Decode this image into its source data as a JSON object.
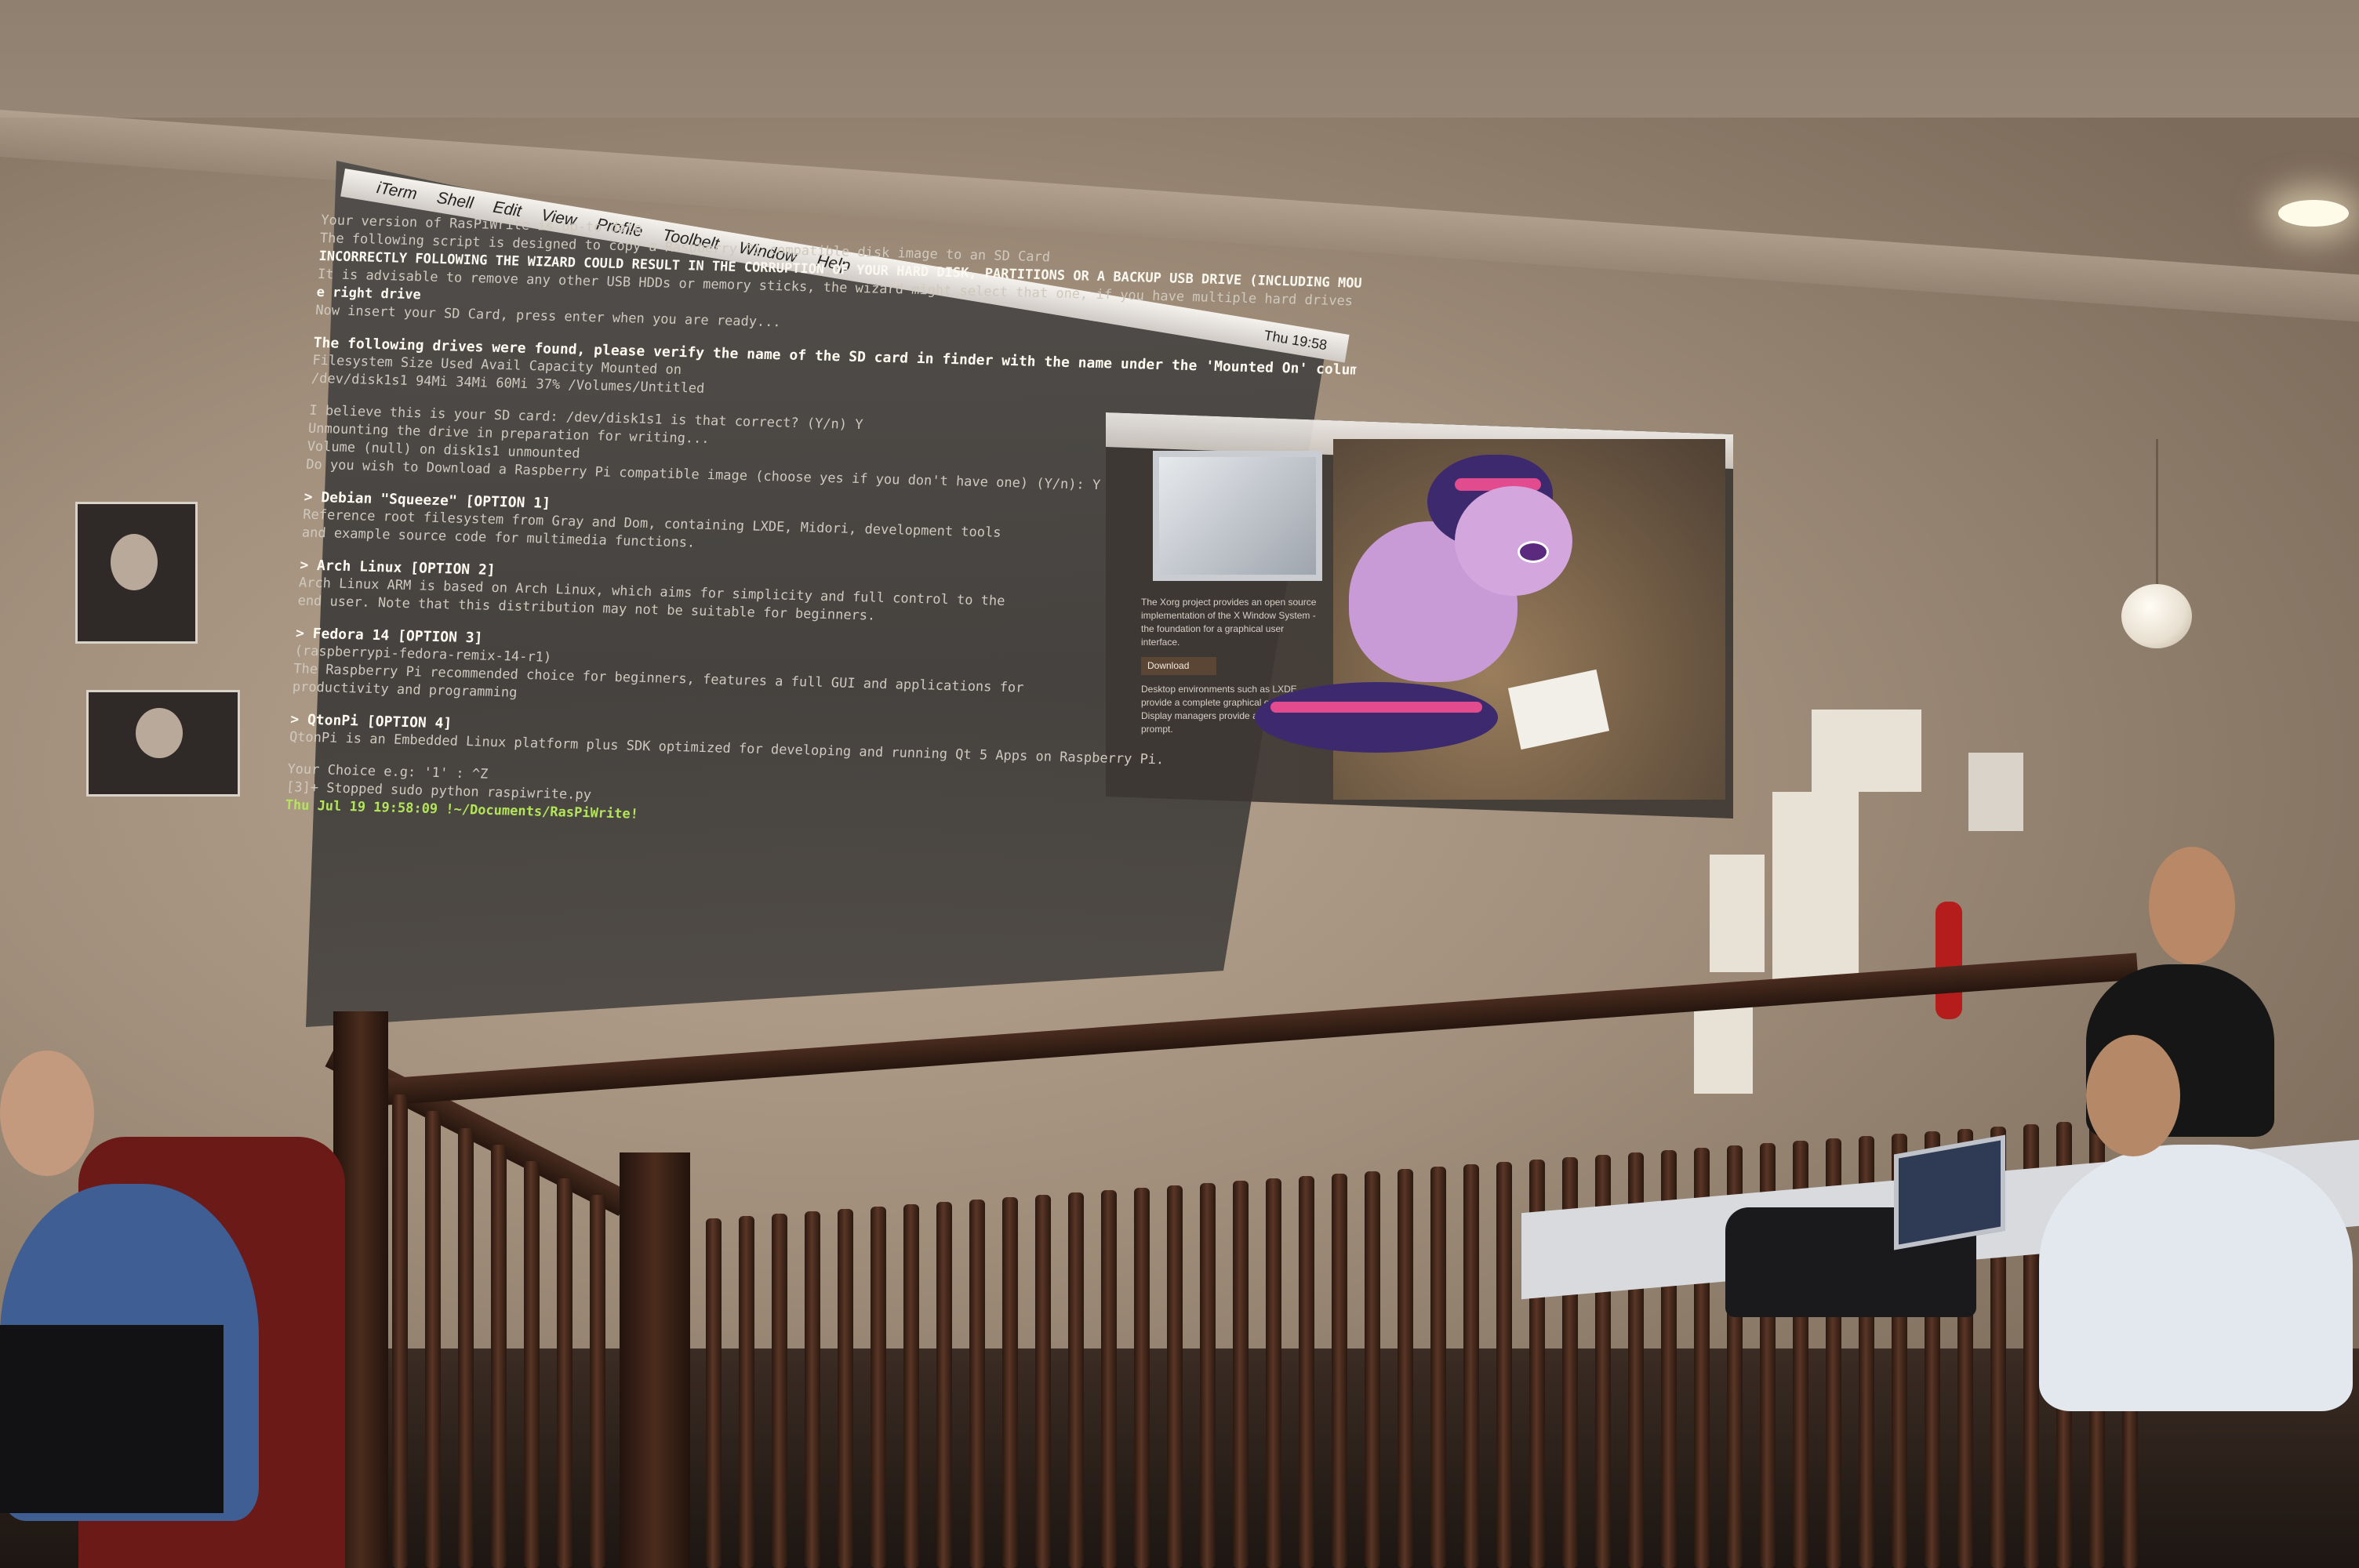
{
  "projection": {
    "menubar": {
      "apple_glyph": "",
      "items": [
        "iTerm",
        "Shell",
        "Edit",
        "View",
        "Profile",
        "Toolbelt",
        "Window",
        "Help"
      ],
      "clock": "Thu 19:58"
    },
    "terminal": {
      "lines": [
        {
          "text": "Your version of RasPiWrite is up-to-date",
          "style": "dim"
        },
        {
          "text": "The following script is designed to copy a Raspberry Pi compatible disk image to an SD Card",
          "style": "dim"
        },
        {
          "text": "INCORRECTLY FOLLOWING THE WIZARD COULD RESULT IN THE CORRUPTION OF YOUR HARD DISK, PARTITIONS OR A BACKUP USB DRIVE (INCLUDING MOUNTED TIME MACHINE BACKUP DRIVES)",
          "style": "bold"
        },
        {
          "text": "It is advisable to remove any other USB HDDs or memory sticks, the wizard might select that one, if you have multiple hard drives installed, please take a LOT of care selecting th",
          "style": "dim"
        },
        {
          "text": "e right drive",
          "style": "bold"
        },
        {
          "text": "Now insert your SD Card, press enter when you are ready...",
          "style": "dim"
        },
        {
          "text": "",
          "style": "gap"
        },
        {
          "text": "The following drives were found, please verify the name of the SD card in finder with the name under the 'Mounted On' column (after \"/Volumes/\"):",
          "style": "hdr"
        },
        {
          "text": "Filesystem    Size   Used   Avail Capacity   Mounted on",
          "style": "dim"
        },
        {
          "text": "/dev/disk1s1   94Mi   34Mi    60Mi    37%    /Volumes/Untitled",
          "style": "dim"
        },
        {
          "text": "",
          "style": "gap"
        },
        {
          "text": "I believe this is your SD card: /dev/disk1s1 is that correct? (Y/n) Y",
          "style": "dim"
        },
        {
          "text": "Unmounting the drive in preparation for writing...",
          "style": "dim"
        },
        {
          "text": "Volume (null) on disk1s1 unmounted",
          "style": "dim"
        },
        {
          "text": "Do you wish to Download a Raspberry Pi compatible image (choose yes if you don't have one) (Y/n): Y",
          "style": "dim"
        },
        {
          "text": "",
          "style": "gap"
        },
        {
          "text": "> Debian \"Squeeze\" [OPTION 1]",
          "style": "hdr"
        },
        {
          "text": "Reference root filesystem from Gray and Dom, containing LXDE, Midori, development tools",
          "style": "dim"
        },
        {
          "text": "and example source code for multimedia functions.",
          "style": "dim"
        },
        {
          "text": "",
          "style": "gap"
        },
        {
          "text": "> Arch Linux [OPTION 2]",
          "style": "hdr"
        },
        {
          "text": "Arch Linux ARM is based on Arch Linux, which aims for simplicity and full control to the",
          "style": "dim"
        },
        {
          "text": "end user. Note that this distribution may not be suitable for beginners.",
          "style": "dim"
        },
        {
          "text": "",
          "style": "gap"
        },
        {
          "text": "> Fedora 14 [OPTION 3]",
          "style": "hdr"
        },
        {
          "text": "(raspberrypi-fedora-remix-14-r1)",
          "style": "dim"
        },
        {
          "text": "The Raspberry Pi recommended choice for beginners, features a full GUI and applications for",
          "style": "dim"
        },
        {
          "text": "productivity and programming",
          "style": "dim"
        },
        {
          "text": "",
          "style": "gap"
        },
        {
          "text": "> QtonPi [OPTION 4]",
          "style": "hdr"
        },
        {
          "text": "QtonPi is an Embedded Linux platform plus SDK optimized for developing and running Qt 5 Apps on Raspberry Pi.",
          "style": "dim"
        },
        {
          "text": "",
          "style": "gap"
        },
        {
          "text": "Your Choice e.g: '1' : ^Z",
          "style": "dim"
        },
        {
          "text": "[3]+  Stopped                 sudo python raspiwrite.py",
          "style": "dim"
        }
      ],
      "prompt": {
        "host": "",
        "datetime": "Thu Jul 19 19:58:09",
        "path": "!~/Documents/RasPiWrite!"
      }
    },
    "browser": {
      "sidebar_lines": [
        "The Xorg project provides an open source",
        "implementation of the X Window System -",
        "the foundation for a graphical user interface.",
        "Desktop environments such as LXDE",
        "provide a complete graphical environment.",
        "Display managers provide a graphical login",
        "prompt."
      ],
      "button": "Download"
    }
  },
  "colors": {
    "terminal_bg": "#3f3d3b",
    "terminal_text": "#e9e6de",
    "prompt_green": "#b3e45a",
    "pony_purple": "#c99bd6",
    "mane_navy": "#3d2a6e",
    "mane_pink": "#e34b8f",
    "rail_wood": "#3a2218",
    "wall": "#a18f7c"
  },
  "icons": [
    "apple-icon",
    "lamp-icon",
    "fire-extinguisher-icon"
  ]
}
